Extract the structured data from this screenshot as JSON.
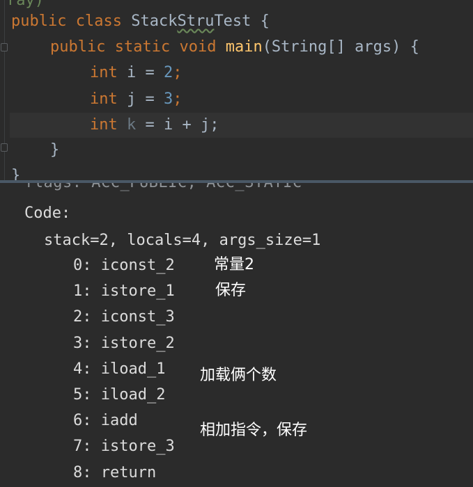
{
  "editor": {
    "partial_top": "ray)",
    "class_decl": {
      "mod": "public",
      "kw": "class",
      "name_a": "Stack",
      "name_b": "Stru",
      "name_c": "Test",
      "brace": "{"
    },
    "method_decl": {
      "mod": "public",
      "static": "static",
      "type": "void",
      "name": "main",
      "params": "(String[] args)",
      "brace": "{"
    },
    "lines": [
      {
        "type": "int",
        "var": "i",
        "op": "=",
        "val": "2",
        "end": ";"
      },
      {
        "type": "int",
        "var": "j",
        "op": "=",
        "val": "3",
        "end": ";"
      }
    ],
    "sum_line": {
      "type": "int",
      "var": "k",
      "expr": "= i + j;"
    },
    "close_method": "}",
    "close_class": "}"
  },
  "bytecode": {
    "flags_line": "flags: ACC_PUBLIC, ACC_STATIC",
    "code_label": "Code:",
    "stack_info": "stack=2, locals=4, args_size=1",
    "instructions": [
      "0: iconst_2",
      "1: istore_1",
      "2: iconst_3",
      "3: istore_2",
      "4: iload_1",
      "5: iload_2",
      "6: iadd",
      "7: istore_3",
      "8: return"
    ],
    "notes": {
      "const": "常量2",
      "save": "保存",
      "load": "加载俩个数",
      "add": "相加指令，保存"
    }
  },
  "colors": {
    "background": "#2b2b2b",
    "keyword": "#cc7832",
    "number": "#6897bb",
    "function": "#ffc66d",
    "text": "#a9b7c6",
    "divider": "#4a5866"
  }
}
